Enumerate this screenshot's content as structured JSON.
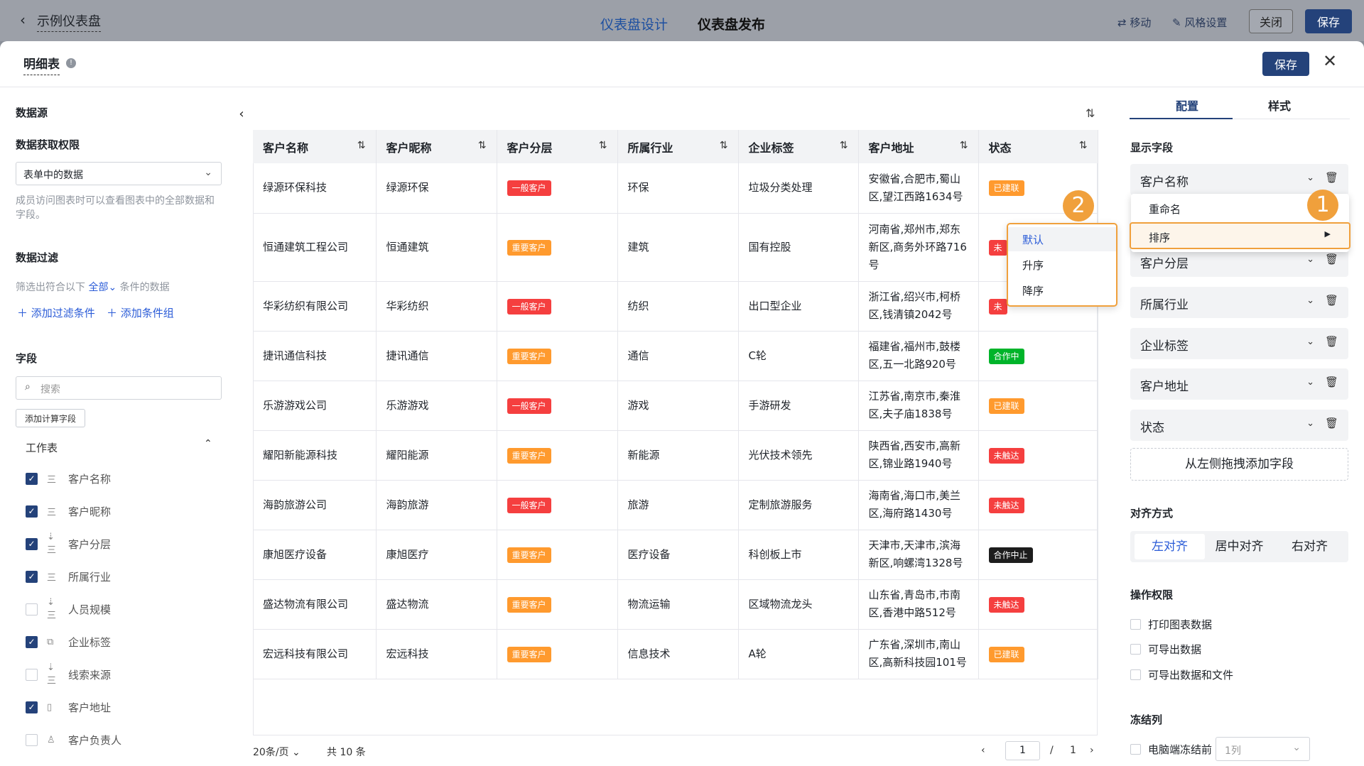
{
  "topbar": {
    "back_title": "示例仪表盘",
    "tab_design": "仪表盘设计",
    "tab_publish": "仪表盘发布",
    "move": "移动",
    "style_settings": "风格设置",
    "close": "关闭",
    "save": "保存"
  },
  "panel": {
    "title": "明细表",
    "save": "保存"
  },
  "left": {
    "datasource": "数据源",
    "permission_label": "数据获取权限",
    "permission_value": "表单中的数据",
    "permission_note": "成员访问图表时可以查看图表中的全部数据和字段。",
    "filter_label": "数据过滤",
    "filter_prefix": "筛选出符合以下",
    "filter_all": "全部",
    "filter_suffix": "条件的数据",
    "add_condition": "添加过滤条件",
    "add_group": "添加条件组",
    "fields_label": "字段",
    "search_placeholder": "搜索",
    "add_calc": "添加计算字段",
    "worksheet": "工作表",
    "fields": [
      {
        "label": "客户名称",
        "checked": true,
        "icon": "三"
      },
      {
        "label": "客户昵称",
        "checked": true,
        "icon": "三"
      },
      {
        "label": "客户分层",
        "checked": true,
        "icon": "⇣三"
      },
      {
        "label": "所属行业",
        "checked": true,
        "icon": "三"
      },
      {
        "label": "人员规模",
        "checked": false,
        "icon": "⇣三"
      },
      {
        "label": "企业标签",
        "checked": true,
        "icon": "⧉"
      },
      {
        "label": "线索来源",
        "checked": false,
        "icon": "⇣三"
      },
      {
        "label": "客户地址",
        "checked": true,
        "icon": "▯"
      },
      {
        "label": "客户负责人",
        "checked": false,
        "icon": "♙"
      }
    ]
  },
  "table": {
    "headers": [
      "客户名称",
      "客户昵称",
      "客户分层",
      "所属行业",
      "企业标签",
      "客户地址",
      "状态"
    ],
    "rows": [
      {
        "name": "绿源环保科技",
        "nick": "绿源环保",
        "tier": "一般客户",
        "industry": "环保",
        "tag": "垃圾分类处理",
        "addr": "安徽省,合肥市,蜀山区,望江西路1634号",
        "status": "已建联"
      },
      {
        "name": "恒通建筑工程公司",
        "nick": "恒通建筑",
        "tier": "重要客户",
        "industry": "建筑",
        "tag": "国有控股",
        "addr": "河南省,郑州市,郑东新区,商务外环路716号",
        "status": "未"
      },
      {
        "name": "华彩纺织有限公司",
        "nick": "华彩纺织",
        "tier": "一般客户",
        "industry": "纺织",
        "tag": "出口型企业",
        "addr": "浙江省,绍兴市,柯桥区,钱清镇2042号",
        "status": "未"
      },
      {
        "name": "捷讯通信科技",
        "nick": "捷讯通信",
        "tier": "重要客户",
        "industry": "通信",
        "tag": "C轮",
        "addr": "福建省,福州市,鼓楼区,五一北路920号",
        "status": "合作中"
      },
      {
        "name": "乐游游戏公司",
        "nick": "乐游游戏",
        "tier": "一般客户",
        "industry": "游戏",
        "tag": "手游研发",
        "addr": "江苏省,南京市,秦淮区,夫子庙1838号",
        "status": "已建联"
      },
      {
        "name": "耀阳新能源科技",
        "nick": "耀阳能源",
        "tier": "重要客户",
        "industry": "新能源",
        "tag": "光伏技术领先",
        "addr": "陕西省,西安市,高新区,锦业路1940号",
        "status": "未触达"
      },
      {
        "name": "海韵旅游公司",
        "nick": "海韵旅游",
        "tier": "一般客户",
        "industry": "旅游",
        "tag": "定制旅游服务",
        "addr": "海南省,海口市,美兰区,海府路1430号",
        "status": "未触达"
      },
      {
        "name": "康旭医疗设备",
        "nick": "康旭医疗",
        "tier": "重要客户",
        "industry": "医疗设备",
        "tag": "科创板上市",
        "addr": "天津市,天津市,滨海新区,响螺湾1328号",
        "status": "合作中止"
      },
      {
        "name": "盛达物流有限公司",
        "nick": "盛达物流",
        "tier": "重要客户",
        "industry": "物流运输",
        "tag": "区域物流龙头",
        "addr": "山东省,青岛市,市南区,香港中路512号",
        "status": "未触达"
      },
      {
        "name": "宏远科技有限公司",
        "nick": "宏远科技",
        "tier": "重要客户",
        "industry": "信息技术",
        "tag": "A轮",
        "addr": "广东省,深圳市,南山区,高新科技园101号",
        "status": "已建联"
      }
    ],
    "page_size": "20条/页",
    "total": "共 10 条",
    "page": "1",
    "page_sep": "/",
    "page_total": "1"
  },
  "colors": {
    "一般客户": "#f53f3f",
    "重要客户": "#ff9a2e",
    "已建联": "#ff9a2e",
    "未": "#f53f3f",
    "未触达": "#f53f3f",
    "合作中": "#00b42a",
    "合作中止": "#1d1d1d",
    "accent": "#24427a",
    "highlight": "#f0a03c"
  },
  "right": {
    "tab_config": "配置",
    "tab_style": "样式",
    "display_fields": "显示字段",
    "fields": [
      "客户名称",
      "客户分层",
      "所属行业",
      "企业标签",
      "客户地址",
      "状态"
    ],
    "menu_rename": "重命名",
    "menu_sort": "排序",
    "sort_default": "默认",
    "sort_asc": "升序",
    "sort_desc": "降序",
    "add_field": "从左侧拖拽添加字段",
    "align_label": "对齐方式",
    "align_left": "左对齐",
    "align_center": "居中对齐",
    "align_right": "右对齐",
    "perm_label": "操作权限",
    "perm_print": "打印图表数据",
    "perm_export": "可导出数据",
    "perm_export_file": "可导出数据和文件",
    "freeze_label": "冻结列",
    "freeze_desktop": "电脑端冻结前",
    "freeze_value": "1列"
  },
  "badges": {
    "one": "1",
    "two": "2"
  }
}
